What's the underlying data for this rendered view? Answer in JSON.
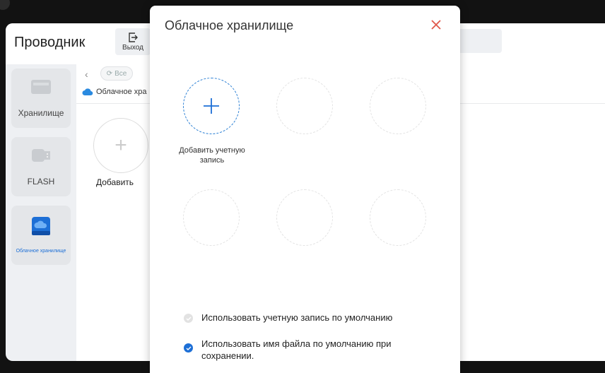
{
  "explorer": {
    "title": "Проводник",
    "exit_label": "Выход",
    "sidebar": [
      {
        "label": "Хранилище",
        "icon": "storage-icon"
      },
      {
        "label": "FLASH",
        "icon": "flash-drive-icon"
      },
      {
        "label": "Облачное хранилище",
        "icon": "cloud-storage-icon",
        "active": true
      }
    ],
    "toolbar": {
      "all_label": "Все"
    },
    "breadcrumb": "Облачное хра",
    "add_label": "Добавить"
  },
  "modal": {
    "title": "Облачное хранилище",
    "add_account_label": "Добавить учетную запись",
    "options": [
      {
        "label": "Использовать учетную запись по умолчанию",
        "checked": false
      },
      {
        "label": "Использовать имя файла по умолчанию при сохранении.",
        "checked": true
      }
    ]
  },
  "colors": {
    "accent": "#1d6fd6",
    "close": "#e0574a"
  }
}
